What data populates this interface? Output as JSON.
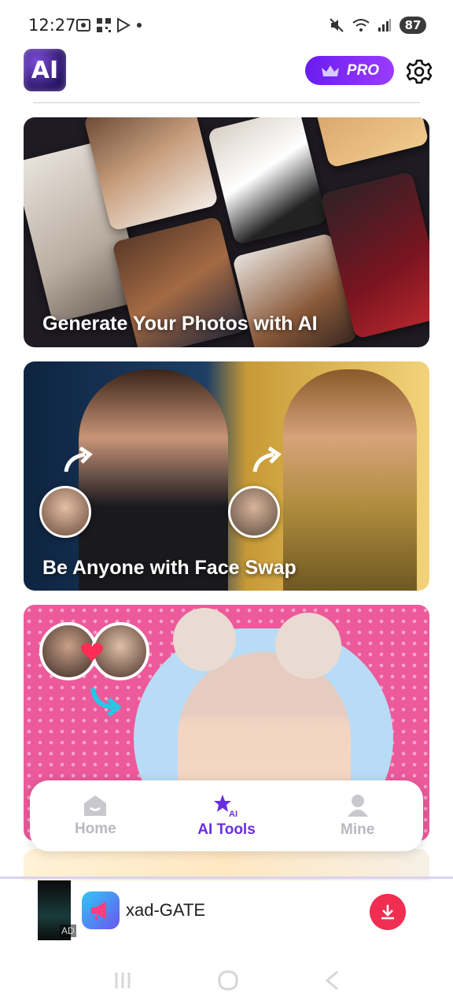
{
  "status_bar": {
    "time": "12:27",
    "battery": "87",
    "icons": [
      "screenshot-icon",
      "qr-icon",
      "play-store-icon",
      "dot-icon",
      "mute-icon",
      "wifi-icon",
      "signal-icon"
    ]
  },
  "header": {
    "logo_text": "AI",
    "pro_label": "PRO"
  },
  "cards": [
    {
      "title": "Generate Your Photos with AI"
    },
    {
      "title": "Be Anyone with Face Swap"
    },
    {
      "title": ""
    }
  ],
  "bottom_nav": {
    "items": [
      {
        "label": "Home",
        "icon": "home-icon",
        "active": false
      },
      {
        "label": "AI Tools",
        "icon": "ai-tools-icon",
        "active": true
      },
      {
        "label": "Mine",
        "icon": "profile-icon",
        "active": false
      }
    ]
  },
  "ad": {
    "badge": "AD",
    "app_name": "xad-GATE"
  },
  "colors": {
    "accent": "#6a2ee0",
    "pro_gradient_start": "#6a1cf0",
    "download_red": "#ef2e52"
  }
}
